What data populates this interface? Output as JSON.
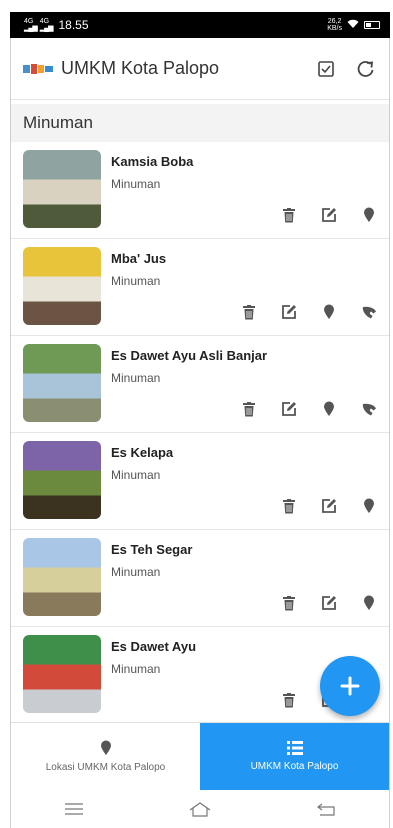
{
  "status_bar": {
    "network1": "4G",
    "network2": "4G",
    "time": "18.55",
    "speed_value": "26,2",
    "speed_unit": "KB/s"
  },
  "app_bar": {
    "title": "UMKM Kota Palopo",
    "logo_icon": "umkm-logo-icon",
    "actions": [
      {
        "name": "checkbox-icon"
      },
      {
        "name": "refresh-icon"
      }
    ]
  },
  "section": {
    "title": "Minuman"
  },
  "items": [
    {
      "name": "Kamsia Boba",
      "category": "Minuman",
      "phone": false,
      "thumb_colors": [
        "#8fa4a0",
        "#d9d2c0",
        "#4f5a3a"
      ]
    },
    {
      "name": "Mba' Jus",
      "category": "Minuman",
      "phone": true,
      "thumb_colors": [
        "#e8c43a",
        "#e9e4d8",
        "#6b5443"
      ]
    },
    {
      "name": "Es Dawet Ayu Asli Banjar",
      "category": "Minuman",
      "phone": true,
      "thumb_colors": [
        "#6e9a55",
        "#a9c4d8",
        "#8a8f72"
      ]
    },
    {
      "name": "Es Kelapa",
      "category": "Minuman",
      "phone": false,
      "thumb_colors": [
        "#7d63a8",
        "#6b8a3e",
        "#3b3220"
      ]
    },
    {
      "name": "Es Teh Segar",
      "category": "Minuman",
      "phone": false,
      "thumb_colors": [
        "#a9c6e6",
        "#d6cf9c",
        "#8a7a5c"
      ]
    },
    {
      "name": "Es Dawet Ayu",
      "category": "Minuman",
      "phone": false,
      "thumb_colors": [
        "#3f8f4a",
        "#d24a3a",
        "#c9cdd2"
      ]
    }
  ],
  "fab": {
    "icon": "plus-icon"
  },
  "bottom_nav": [
    {
      "label": "Lokasi UMKM Kota Palopo",
      "icon": "location-pin-icon",
      "active": false
    },
    {
      "label": "UMKM Kota Palopo",
      "icon": "list-icon",
      "active": true
    }
  ],
  "colors": {
    "primary": "#2196f3",
    "icon_gray": "#555555",
    "section_bg": "#f3f3f3"
  }
}
